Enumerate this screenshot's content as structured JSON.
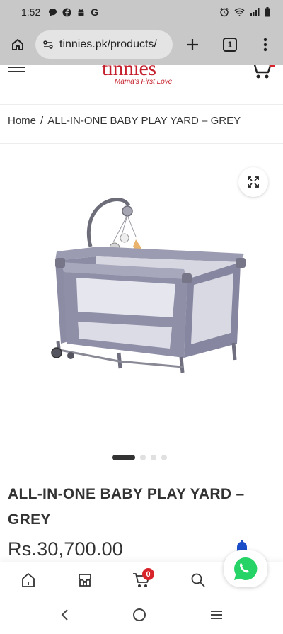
{
  "status_bar": {
    "time": "1:52",
    "left_icons": [
      "chat-icon",
      "facebook-icon",
      "android-icon",
      "google-icon"
    ],
    "right_icons": [
      "alarm-icon",
      "wifi-icon",
      "signal-icon",
      "battery-icon"
    ]
  },
  "browser": {
    "url": "tinnies.pk/products/",
    "tab_count": "1"
  },
  "site": {
    "logo_text": "tinnies",
    "logo_tagline": "Mama's First Love"
  },
  "breadcrumb": {
    "home": "Home",
    "separator": "/",
    "current": "ALL-IN-ONE BABY PLAY YARD – GREY"
  },
  "gallery": {
    "slide_count": 4,
    "active_slide": 1
  },
  "product": {
    "title": "ALL-IN-ONE BABY PLAY YARD – GREY",
    "price": "Rs.30,700.00"
  },
  "bottom_bar": {
    "cart_count": "0"
  },
  "colors": {
    "brand": "#c41f2b",
    "badge": "#d8232a",
    "whatsapp": "#25d366",
    "bell": "#1a4ec8"
  }
}
